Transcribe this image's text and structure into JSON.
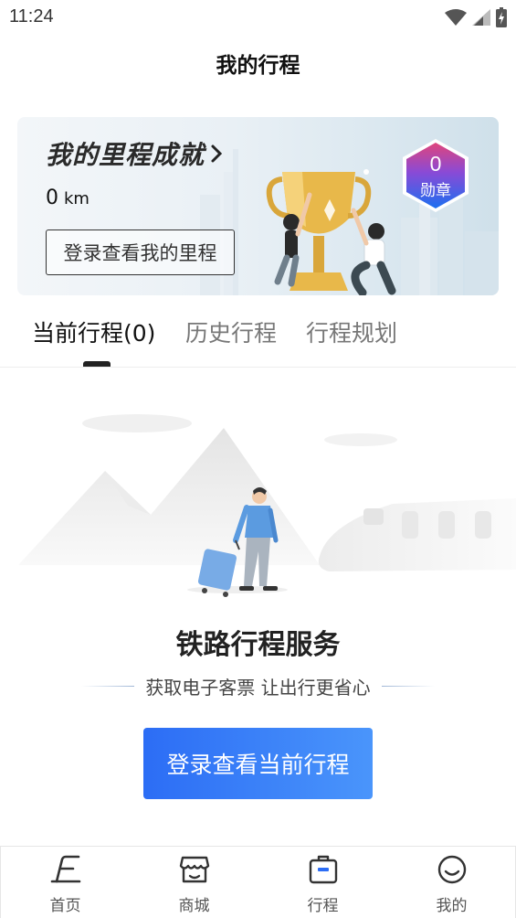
{
  "status_bar": {
    "time": "11:24",
    "icons": [
      "wifi-icon",
      "signal-icon",
      "battery-charging-icon"
    ]
  },
  "header": {
    "title": "我的行程"
  },
  "mileage_card": {
    "title": "我的里程成就",
    "title_chevron": "chevron-right-icon",
    "distance_value": "0",
    "distance_unit": "km",
    "login_label": "登录查看我的里程",
    "medal_count": "0",
    "medal_label": "勋章"
  },
  "tabs": [
    {
      "label": "当前行程(0)",
      "active": true
    },
    {
      "label": "历史行程",
      "active": false
    },
    {
      "label": "行程规划",
      "active": false
    }
  ],
  "empty_state": {
    "title": "铁路行程服务",
    "subtitle": "获取电子客票 让出行更省心",
    "button_label": "登录查看当前行程"
  },
  "bottom_nav": [
    {
      "label": "首页",
      "icon": "home-icon",
      "active": false
    },
    {
      "label": "商城",
      "icon": "shop-icon",
      "active": false
    },
    {
      "label": "行程",
      "icon": "trip-bag-icon",
      "active": true
    },
    {
      "label": "我的",
      "icon": "profile-icon",
      "active": false
    }
  ],
  "colors": {
    "accent": "#2c6df5",
    "accent_light": "#4a95fb",
    "badge_top": "#e0457b",
    "badge_bottom": "#1c6ff0"
  }
}
